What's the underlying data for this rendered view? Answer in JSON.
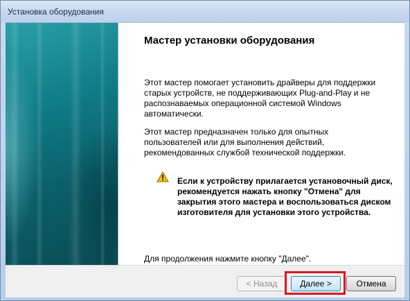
{
  "window": {
    "title": "Установка оборудования"
  },
  "wizard": {
    "heading": "Мастер установки оборудования",
    "intro_lines": [
      "Этот мастер помогает установить драйверы для поддержки",
      "старых устройств, не поддерживающих Plug-and-Play и не",
      "распознаваемых операционной системой Windows",
      "автоматически."
    ],
    "audience_lines": [
      "Этот мастер предназначен только для опытных",
      "пользователей или для выполнения действий,",
      "рекомендованных службой технической поддержки."
    ],
    "warning_lines": [
      "Если к устройству прилагается установочный диск,",
      "рекомендуется нажать кнопку \"Отмена\" для",
      "закрытия этого мастера и воспользоваться диском",
      "изготовителя для установки этого устройства."
    ],
    "continue_text": "Для продолжения нажмите кнопку \"Далее\"."
  },
  "footer": {
    "back_label": "< Назад",
    "next_label": "Далее >",
    "cancel_label": "Отмена"
  },
  "colors": {
    "highlight": "#e0141e",
    "banner": "#0f7c86",
    "warning_icon": "#f2c200"
  }
}
